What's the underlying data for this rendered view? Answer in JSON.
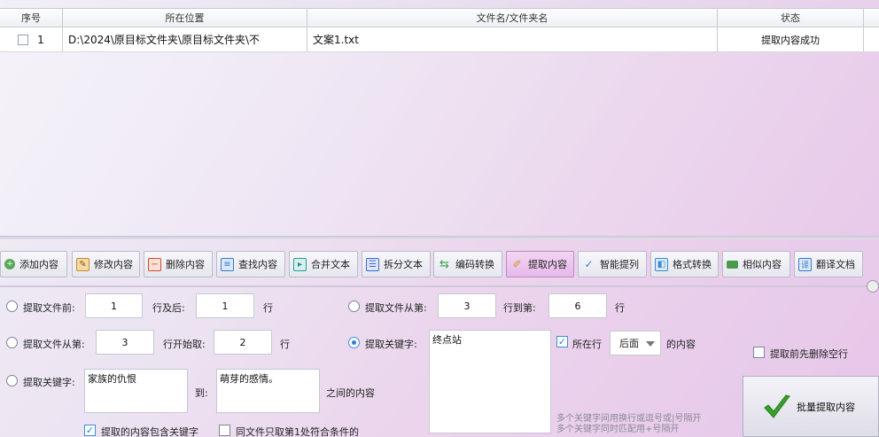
{
  "table": {
    "headers": [
      "序号",
      "所在位置",
      "文件名/文件夹名",
      "状态"
    ],
    "rows": [
      {
        "index": "1",
        "location": "D:\\2024\\原目标文件夹\\原目标文件夹\\不",
        "filename": "文案1.txt",
        "status": "提取内容成功"
      }
    ]
  },
  "toolbar": {
    "buttons": [
      {
        "label": "添加内容",
        "icon": "add-circle-icon",
        "color": "#3a9a3a"
      },
      {
        "label": "修改内容",
        "icon": "edit-doc-icon",
        "color": "#c98a2a"
      },
      {
        "label": "删除内容",
        "icon": "delete-doc-icon",
        "color": "#d04a2a"
      },
      {
        "label": "查找内容",
        "icon": "find-doc-icon",
        "color": "#3a78c8"
      },
      {
        "label": "合并文本",
        "icon": "merge-icon",
        "color": "#2a9a9a"
      },
      {
        "label": "拆分文本",
        "icon": "split-icon",
        "color": "#3a6ad0"
      },
      {
        "label": "编码转换",
        "icon": "convert-icon",
        "color": "#3aa04a"
      },
      {
        "label": "提取内容",
        "icon": "extract-icon",
        "color": "#c8a020",
        "active": true
      },
      {
        "label": "智能提列",
        "icon": "smart-column-icon",
        "color": "#4a7ac8"
      },
      {
        "label": "格式转换",
        "icon": "format-icon",
        "color": "#3a8ad0"
      },
      {
        "label": "相似内容",
        "icon": "similar-icon",
        "color": "#3a8a3a"
      },
      {
        "label": "翻译文档",
        "icon": "translate-icon",
        "color": "#3a7ad0"
      }
    ]
  },
  "options": {
    "opt1": {
      "label": "提取文件前:",
      "value1": "1",
      "mid": "行及后:",
      "value2": "1",
      "suffix": "行",
      "selected": false
    },
    "opt2": {
      "label": "提取文件从第:",
      "value1": "3",
      "mid": "行到第:",
      "value2": "6",
      "suffix": "行",
      "selected": false
    },
    "opt3": {
      "label": "提取文件从第:",
      "value1": "3",
      "mid": "行开始取:",
      "value2": "2",
      "suffix": "行",
      "selected": false
    },
    "opt4": {
      "label": "提取关键字:",
      "keyword": "终点站",
      "selected": true,
      "line_checkbox_label": "所在行",
      "line_checked": true,
      "position": "后面",
      "position_suffix": "的内容",
      "hint1": "多个关键字间用换行或逗号或|号隔开",
      "hint2": "多个关键字同时匹配用+号隔开"
    },
    "opt5": {
      "label": "提取关键字:",
      "from": "家族的仇恨",
      "to_label": "到:",
      "to": "萌芽的感情。",
      "suffix": "之间的内容",
      "selected": false
    },
    "include_keyword": {
      "label": "提取的内容包含关键字",
      "checked": true
    },
    "first_match_only": {
      "label": "同文件只取第1处符合条件的",
      "checked": false
    },
    "remove_blank": {
      "label": "提取前先删除空行",
      "checked": false
    }
  },
  "action": {
    "label": "批量提取内容"
  },
  "colors": {
    "accent": "#2a7fd6",
    "check_green": "#3aa02a"
  }
}
